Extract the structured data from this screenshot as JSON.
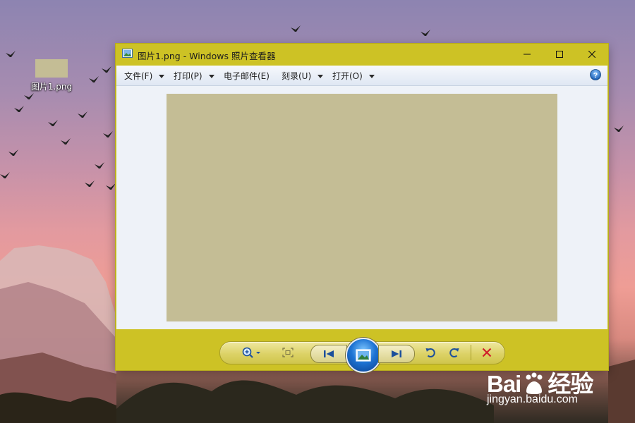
{
  "desktop": {
    "icon_label": "图片1.png",
    "thumbnail_color": "#c4bd95"
  },
  "window": {
    "title": "图片1.png - Windows 照片查看器",
    "accent_color": "#cdc225",
    "controls": [
      "minimize-icon",
      "maximize-icon",
      "close-icon"
    ]
  },
  "menu": {
    "items": [
      {
        "label": "文件(F)",
        "has_dropdown": true
      },
      {
        "label": "打印(P)",
        "has_dropdown": true
      },
      {
        "label": "电子邮件(E)",
        "has_dropdown": false
      },
      {
        "label": "刻录(U)",
        "has_dropdown": true
      },
      {
        "label": "打开(O)",
        "has_dropdown": true
      }
    ],
    "help_icon": "help-icon"
  },
  "viewer": {
    "image_color": "#c4bd95",
    "background_color": "#eef2f8"
  },
  "toolbar": {
    "buttons": [
      "zoom-icon",
      "actual-size-icon",
      "previous-icon",
      "slideshow-icon",
      "next-icon",
      "rotate-ccw-icon",
      "rotate-cw-icon",
      "delete-icon"
    ]
  },
  "watermark": {
    "brand_left": "Bai",
    "brand_right": "经验",
    "url": "jingyan.baidu.com"
  }
}
